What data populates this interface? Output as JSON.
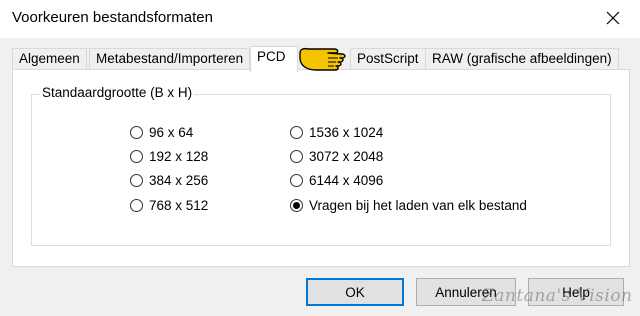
{
  "window": {
    "title": "Voorkeuren bestandsformaten"
  },
  "tabs": [
    {
      "label": "Algemeen",
      "active": false
    },
    {
      "label": "Metabestand/Importeren",
      "active": false
    },
    {
      "label": "PCD",
      "active": true
    },
    {
      "label": "PostScript",
      "active": false
    },
    {
      "label": "RAW (grafische afbeeldingen)",
      "active": false
    }
  ],
  "group": {
    "label": "Standaardgrootte (B x H)",
    "options": [
      {
        "label": "96 x 64",
        "selected": false
      },
      {
        "label": "192 x 128",
        "selected": false
      },
      {
        "label": "384 x 256",
        "selected": false
      },
      {
        "label": "768 x 512",
        "selected": false
      },
      {
        "label": "1536 x 1024",
        "selected": false
      },
      {
        "label": "3072 x 2048",
        "selected": false
      },
      {
        "label": "6144 x 4096",
        "selected": false
      },
      {
        "label": "Vragen bij het laden van elk bestand",
        "selected": true
      }
    ]
  },
  "buttons": {
    "ok": "OK",
    "cancel": "Annuleren",
    "help": "Help"
  },
  "watermark": "Zantana's Vision",
  "colors": {
    "accent": "#0078d7",
    "pointer": "#f5c400"
  },
  "icons": {
    "close": "close-icon",
    "pointer": "pointing-hand-icon"
  }
}
